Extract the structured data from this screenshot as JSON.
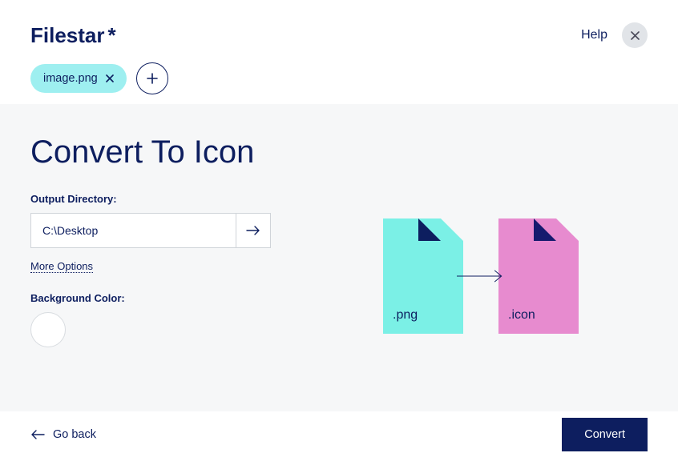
{
  "header": {
    "logo_text": "Filestar",
    "logo_suffix": "*",
    "help_label": "Help"
  },
  "chips": {
    "file_name": "image.png"
  },
  "main": {
    "title": "Convert To Icon",
    "output_label": "Output Directory:",
    "output_value": "C:\\Desktop",
    "more_options_label": "More Options",
    "bg_color_label": "Background Color:",
    "bg_color_value": "#ffffff",
    "from_ext": ".png",
    "to_ext": ".icon"
  },
  "footer": {
    "go_back_label": "Go back",
    "convert_label": "Convert"
  },
  "colors": {
    "primary": "#0d1e5f",
    "teal": "#7bf0e6",
    "pink": "#e78bcf",
    "chip": "#9eeff0"
  }
}
